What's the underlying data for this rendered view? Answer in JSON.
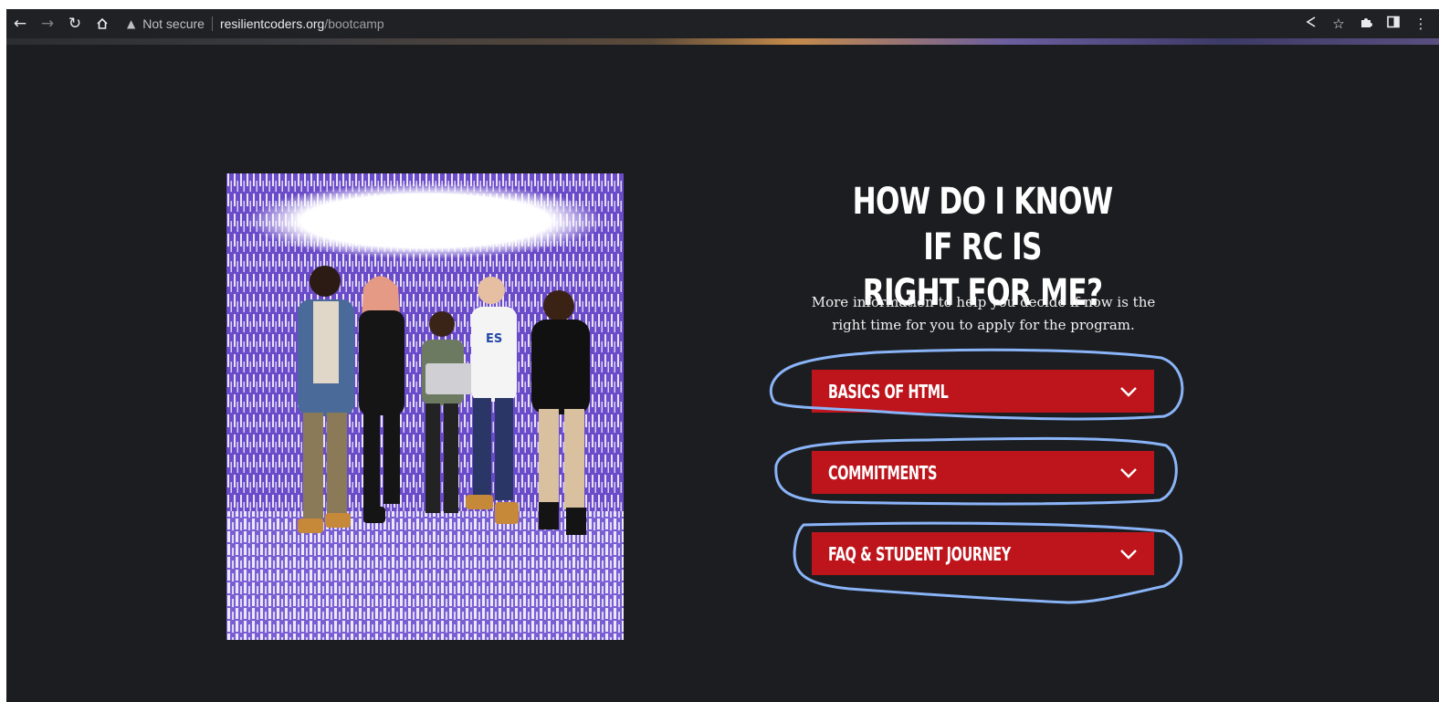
{
  "browser": {
    "security_label": "Not secure",
    "url_host": "resilientcoders.org",
    "url_path": "/bootcamp",
    "nav_icons": [
      "back-arrow-icon",
      "forward-arrow-icon",
      "reload-icon",
      "home-icon"
    ],
    "toolbar_icons": [
      "share-icon",
      "bookmark-star-icon",
      "extensions-puzzle-icon",
      "side-panel-icon",
      "more-menu-icon"
    ]
  },
  "section": {
    "heading_line1": "HOW DO I KNOW IF RC IS",
    "heading_line2": "RIGHT FOR ME?",
    "subtext_line1": "More information to help you decide if now is the",
    "subtext_line2": "right time for you to apply for the program.",
    "accordions": [
      {
        "label": "BASICS OF HTML"
      },
      {
        "label": "COMMITMENTS"
      },
      {
        "label": "FAQ & STUDENT JOURNEY"
      }
    ]
  },
  "colors": {
    "page_bg": "#1c1d20",
    "accordion_bg": "#be151d",
    "annotation_stroke": "#8ab4f8"
  }
}
